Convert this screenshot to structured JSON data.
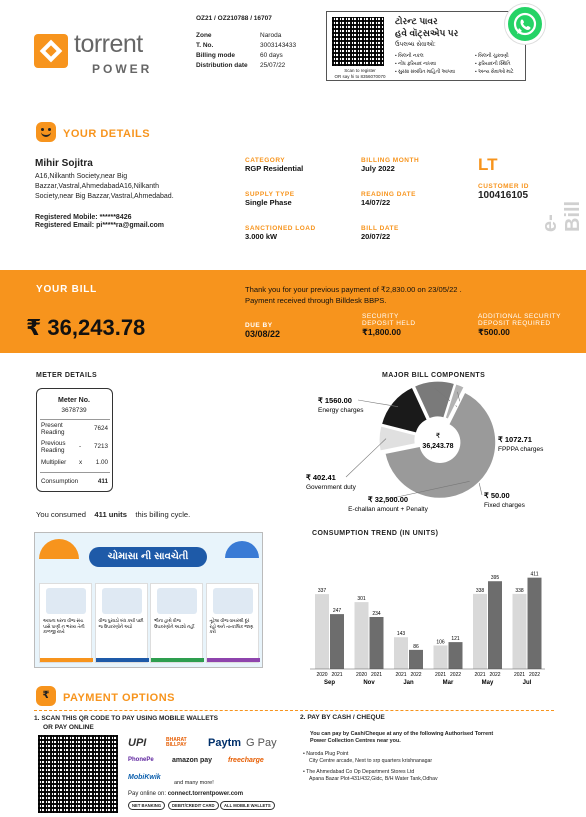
{
  "header": {
    "brand_name": "torrent",
    "brand_sub": "POWER",
    "bill_ref": "OZ21 / OZ210788 / 16707",
    "info": [
      {
        "k": "Zone",
        "v": "Naroda"
      },
      {
        "k": "T. No.",
        "v": "3003143433"
      },
      {
        "k": "Billing mode",
        "v": "60 days"
      },
      {
        "k": "Distribution date",
        "v": "25/07/22"
      }
    ],
    "wa_line1": "ટોરન્ટ પાવર",
    "wa_line2": "હવે વૉટ્સએપ પર",
    "wa_line3": "ઉપલબ્ધ સેવાઓ:",
    "wa_services_left": [
      "બિલની નકલ",
      "નોંધ ફરિયાદ નાખવા",
      "સુરક્ષા સંબંધિત માહિતી આપવા"
    ],
    "wa_services_right": [
      "બિલની ચુકવણી",
      "ફરિયાદની સ્થિતિ",
      "અન્ય સેવાઓ માટે"
    ],
    "wa_scan": "Scan to register",
    "wa_say_hi": "OR say hi to 8356070070"
  },
  "details": {
    "title": "YOUR DETAILS",
    "name": "Mihir Sojitra",
    "address": "A16,Nilkanth Society,near Big Bazzar,Vastral,AhmedabadA16,Nilkanth Society,near Big Bazzar,Vastral,Ahmedabad.",
    "mobile_label": "Registered Mobile:",
    "mobile": "******8426",
    "email_label": "Registered Email:",
    "email": "pi*****ra@gmail.com",
    "category_label": "CATEGORY",
    "category": "RGP Residential",
    "supply_label": "SUPPLY TYPE",
    "supply": "Single Phase",
    "load_label": "SANCTIONED LOAD",
    "load": "3.000 kW",
    "billing_month_label": "BILLING MONTH",
    "billing_month": "July 2022",
    "reading_date_label": "READING DATE",
    "reading_date": "14/07/22",
    "bill_date_label": "BILL DATE",
    "bill_date": "20/07/22",
    "tariff": "LT",
    "customer_id_label": "CUSTOMER ID",
    "customer_id": "100416105",
    "ebill": "e-Bill"
  },
  "bill": {
    "title": "YOUR BILL",
    "amount": "₹ 36,243.78",
    "msg1": "Thank you for your previous payment of ₹2,830.00 on 23/05/22 .",
    "msg2": "Payment received through Billdesk BBPS.",
    "due_label": "DUE BY",
    "due": "03/08/22",
    "sd_label1": "SECURITY",
    "sd_label2": "DEPOSIT HELD",
    "sd": "₹1,800.00",
    "asd_label1": "ADDITIONAL SECURITY",
    "asd_label2": "DEPOSIT REQUIRED",
    "asd": "₹500.00"
  },
  "meter": {
    "title": "METER DETAILS",
    "no_label": "Meter No.",
    "no": "3678739",
    "present_label": "Present Reading",
    "present": "7624",
    "previous_label": "Previous Reading",
    "previous": "7213",
    "minus": "-",
    "multiplier_label": "Multiplier",
    "x": "x",
    "multiplier": "1.00",
    "consumption_label": "Consumption",
    "consumption": "411",
    "consumed_prefix": "You consumed",
    "consumed_units": "411 units",
    "consumed_suffix": "this billing cycle."
  },
  "monsoon": {
    "title": "ચોમાસા ની સાવચેતી",
    "tips": [
      "આપના ઘરના વીજ સંચ પાસે પાણી ન ભરાય તેની કાળજી રાખો",
      "વીજ પુરવઠો બંધ કર્યા પછી જ ઉપકરણોને અડો",
      "ભીના હાથે વીજ ઉપકરણોને અડશો નહીં",
      "તૂટેલા વીજ વાયરથી દૂર રહો અને તાત્કાલિક જાણ કરો"
    ]
  },
  "components": {
    "title": "MAJOR BILL COMPONENTS",
    "center_symbol": "₹",
    "center_value": "36,243.78"
  },
  "trend": {
    "title": "CONSUMPTION TREND (IN UNITS)"
  },
  "chart_data": [
    {
      "type": "pie",
      "title": "MAJOR BILL COMPONENTS",
      "labels": [
        "Energy charges",
        "FPPPA charges",
        "Fixed charges",
        "E-challan amount + Penalty",
        "Government duty"
      ],
      "values": [
        1560.0,
        1072.71,
        50.0,
        32500.0,
        402.41
      ],
      "display": [
        "₹ 1560.00",
        "₹ 1072.71",
        "₹ 50.00",
        "₹ 32,500.00",
        "₹ 402.41"
      ],
      "colors": [
        "#1a1a1a",
        "#7a7a7a",
        "#b3b3b3",
        "#9a9a9a",
        "#e0e0e0"
      ]
    },
    {
      "type": "bar",
      "title": "CONSUMPTION TREND (IN UNITS)",
      "categories": [
        "Sep",
        "Nov",
        "Jan",
        "Mar",
        "May",
        "Jul"
      ],
      "series": [
        {
          "name": "2020",
          "values": [
            337,
            301,
            143,
            106,
            338,
            338
          ],
          "year_labels": [
            "2020",
            "2020",
            "2021",
            "2021",
            "2021",
            "2021"
          ],
          "color": "#d9d9d9"
        },
        {
          "name": "2021",
          "values": [
            247,
            234,
            86,
            121,
            395,
            411
          ],
          "year_labels": [
            "2021",
            "2021",
            "2022",
            "2022",
            "2022",
            "2022"
          ],
          "color": "#6d6d6d"
        }
      ],
      "ylim": [
        0,
        450
      ]
    }
  ],
  "payment": {
    "title": "PAYMENT OPTIONS",
    "opt1_title1": "1. SCAN THIS QR CODE TO PAY USING MOBILE WALLETS",
    "opt1_title2": "OR PAY ONLINE",
    "online_label": "Pay online on:",
    "online_url": "connect.torrentpower.com",
    "chips": [
      "NET BANKING",
      "DEBIT/CREDIT CARD",
      "ALL MOBILE WALLETS"
    ],
    "wallets": [
      "UPI",
      "BHARAT BILLPAY",
      "Paytm",
      "G Pay",
      "PhonePe",
      "amazon pay",
      "freecharge",
      "MobiKwik"
    ],
    "many_more": "and many more!",
    "opt2_title": "2. PAY BY CASH / CHEQUE",
    "opt2_text": "You can pay by Cash/Cheque at any of the following Authorised Torrent Power Collection Centres near you.",
    "centres": [
      {
        "name": "Naroda Plug Point",
        "addr": "City Centre arcade, Next to srp quarters krishnanagar"
      },
      {
        "name": "The Ahmedabad Co Op Department Stores Ltd",
        "addr": "Apana Bazar Plot-431/432,Gidc, B/H Water Tank,Odhav"
      }
    ]
  }
}
